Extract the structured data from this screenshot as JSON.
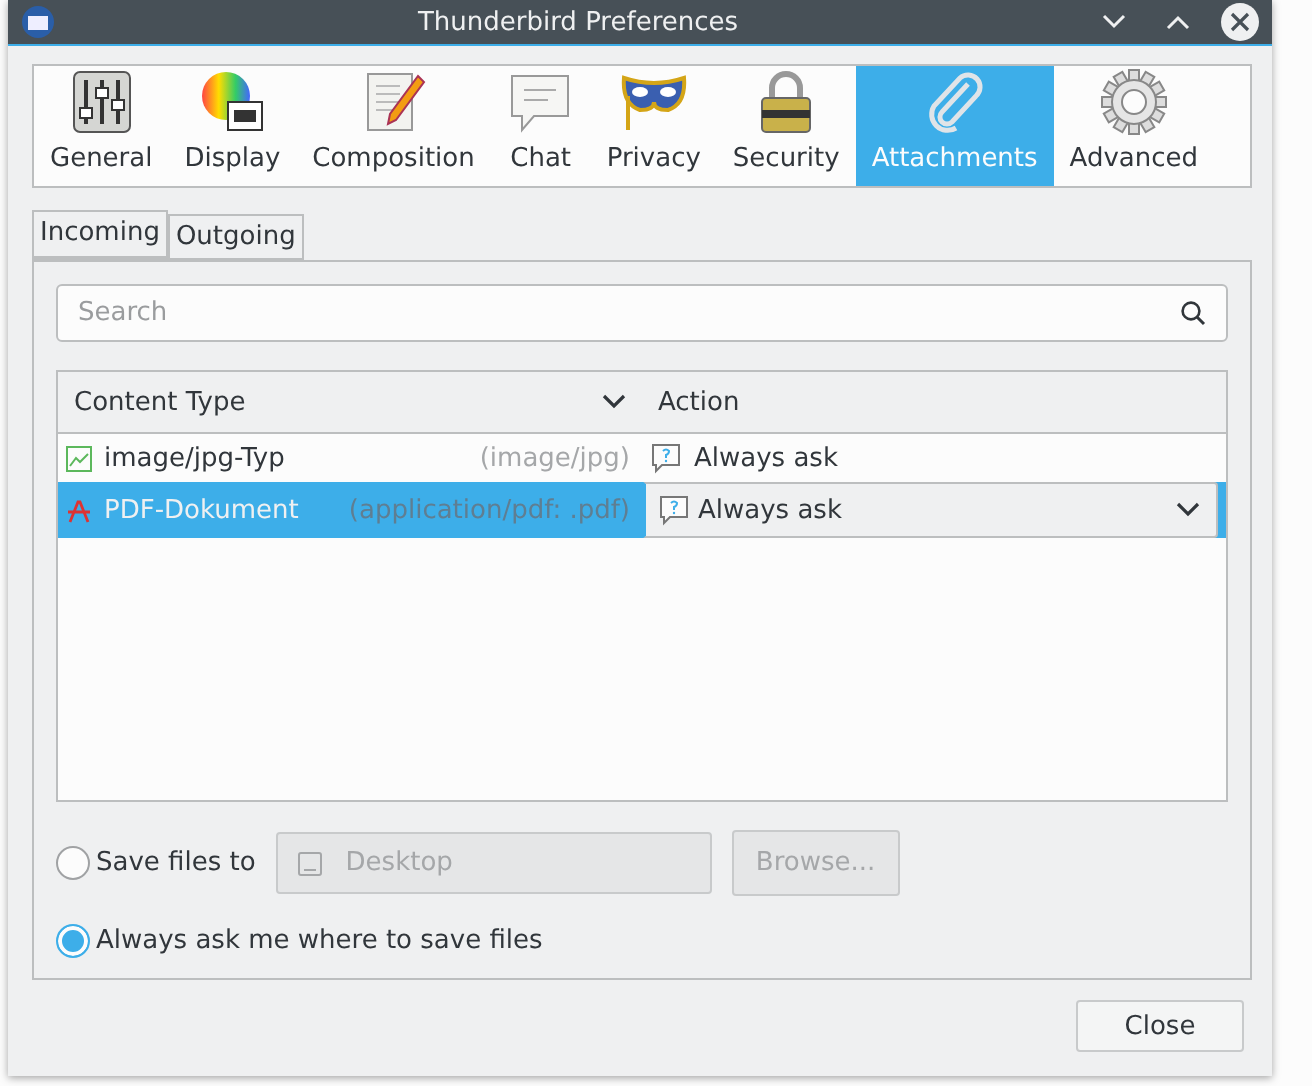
{
  "window": {
    "title": "Thunderbird Preferences"
  },
  "categories": [
    {
      "label": "General",
      "selected": false
    },
    {
      "label": "Display",
      "selected": false
    },
    {
      "label": "Composition",
      "selected": false
    },
    {
      "label": "Chat",
      "selected": false
    },
    {
      "label": "Privacy",
      "selected": false
    },
    {
      "label": "Security",
      "selected": false
    },
    {
      "label": "Attachments",
      "selected": true
    },
    {
      "label": "Advanced",
      "selected": false
    }
  ],
  "tabs": [
    {
      "label": "Incoming",
      "selected": true
    },
    {
      "label": "Outgoing",
      "selected": false
    }
  ],
  "search": {
    "placeholder": "Search"
  },
  "table": {
    "columns": [
      "Content Type",
      "Action"
    ],
    "rows": [
      {
        "kind": "image",
        "type": "image/jpg-Typ",
        "mime": "(image/jpg)",
        "action": "Always ask",
        "selected": false
      },
      {
        "kind": "pdf",
        "type": "PDF-Dokument",
        "mime": "(application/pdf: .pdf)",
        "action": "Always ask",
        "selected": true
      }
    ]
  },
  "save": {
    "options": [
      {
        "label": "Save files to",
        "selected": false
      },
      {
        "label": "Always ask me where to save files",
        "selected": true
      }
    ],
    "folder": "Desktop",
    "browse": "Browse...",
    "disabled": true
  },
  "buttons": [
    "Close"
  ]
}
